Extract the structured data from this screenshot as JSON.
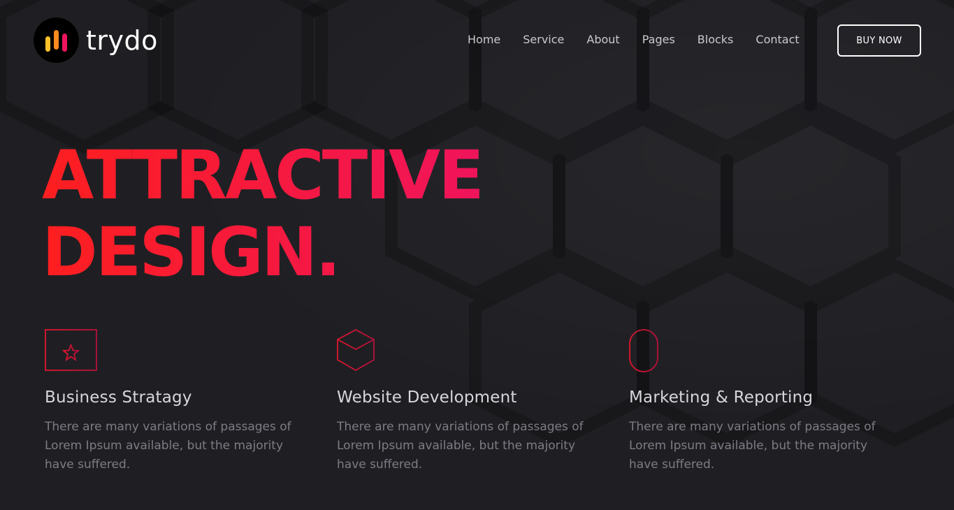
{
  "brand": {
    "name": "trydo",
    "accent": "#f81f4e",
    "logo_bars": [
      "#ffc12b",
      "#ff8a1f",
      "#f0145c"
    ]
  },
  "nav": {
    "items": [
      "Home",
      "Service",
      "About",
      "Pages",
      "Blocks",
      "Contact"
    ],
    "cta_label": "BUY NOW"
  },
  "hero": {
    "line1": "ATTRACTIVE",
    "line2": "DESIGN.",
    "gradient": [
      "#fd1f1f",
      "#f0145c"
    ]
  },
  "services": [
    {
      "icon": "browser-star-icon",
      "title": "Business Stratagy",
      "description": "There are many variations of passages of Lorem Ipsum available, but the majority have suffered."
    },
    {
      "icon": "cube-icon",
      "title": "Website Development",
      "description": "There are many variations of passages of Lorem Ipsum available, but the majority have suffered."
    },
    {
      "icon": "mouse-icon",
      "title": "Marketing & Reporting",
      "description": "There are many variations of passages of Lorem Ipsum available, but the majority have suffered."
    }
  ]
}
